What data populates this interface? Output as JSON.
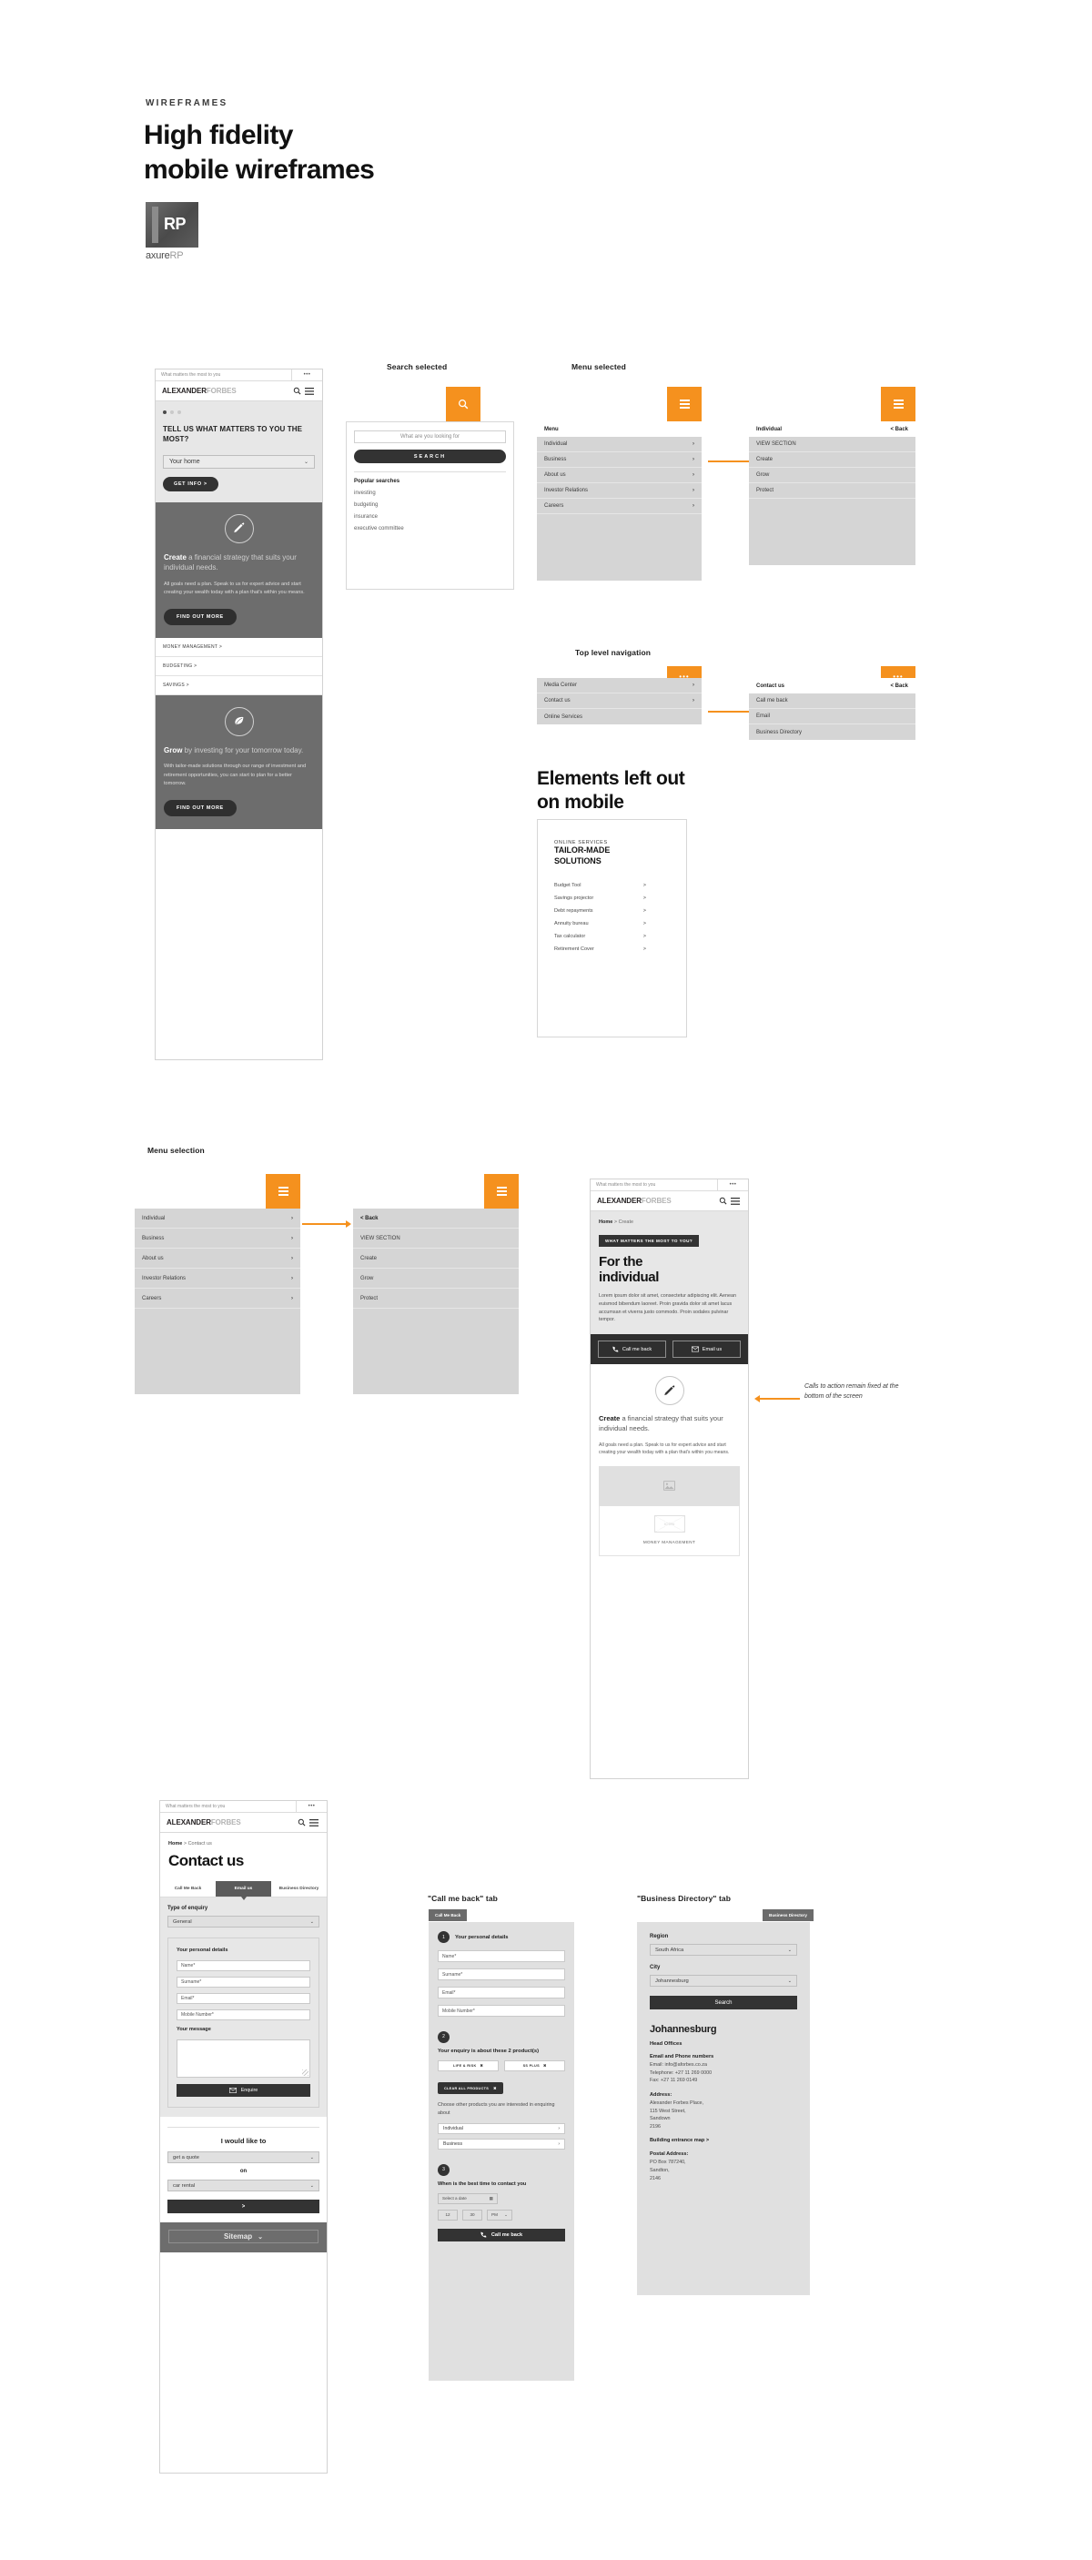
{
  "intro": {
    "kicker": "WIREFRAMES",
    "title_line1": "High fidelity",
    "title_line2": "mobile wireframes",
    "logo_mark": "RP",
    "logo_word": "axure",
    "logo_word_light": "RP"
  },
  "colors": {
    "accent": "#f5911e",
    "dark": "#333333",
    "panel_gray": "#6d6d6d",
    "menu_gray": "#d5d5d5",
    "hero_gray": "#e7e7e7"
  },
  "captions": {
    "search_selected": "Search selected",
    "menu_selected": "Menu selected",
    "top_level_navigation": "Top level navigation",
    "menu_selection": "Menu selection",
    "call_me_back_tab": "\"Call me back\" tab",
    "business_directory_tab": "\"Business Directory\" tab"
  },
  "headings": {
    "elements_left_out_l1": "Elements left out",
    "elements_left_out_l2": "on mobile"
  },
  "annotations": {
    "cta_fixed": "Calls to action remain fixed at the bottom of the screen"
  },
  "browser": {
    "url_text": "What matters the most to you",
    "dots": "•••"
  },
  "brand": {
    "name_bold": "ALEXANDER",
    "name_light": "FORBES"
  },
  "home": {
    "hero_heading": "TELL US WHAT MATTERS TO YOU THE MOST?",
    "select_value": "Your home",
    "cta": "GET INFO >",
    "create": {
      "title_bold": "Create",
      "title_rest": " a financial strategy that suits your individual needs.",
      "body": "All goals need a plan. Speak to us for expert advice and start creating your wealth today with a plan that's within you means.",
      "button": "FIND OUT MORE",
      "icon": "pencil-icon"
    },
    "links": [
      "MONEY MANAGEMENT >",
      "BUDGETING >",
      "SAVINGS >"
    ],
    "grow": {
      "title_bold": "Grow",
      "title_rest": " by investing for your tomorrow today.",
      "body": "With tailor-made solutions through our range of investment and retirement opportunities, you can start to plan for a better tomorrow.",
      "button": "FIND OUT MORE",
      "icon": "leaf-icon"
    }
  },
  "search_dropdown": {
    "input_placeholder": "What are you looking for",
    "search_button": "SEARCH",
    "popular_title": "Popular searches",
    "popular_items": [
      "investing",
      "budgeting",
      "insurance",
      "executive committee"
    ]
  },
  "menu_dropdown": {
    "header": "Menu",
    "items": [
      "Individual",
      "Business",
      "About us",
      "Investor Relations",
      "Careers"
    ]
  },
  "individual_dropdown": {
    "header": "Individual",
    "back": "< Back",
    "items": [
      "VIEW SECTION",
      "Create",
      "Grow",
      "Protect"
    ]
  },
  "toplevel_dropdown": {
    "items": [
      "Media Center",
      "Contact us",
      "Online Services"
    ]
  },
  "contact_dropdown": {
    "header": "Contact us",
    "back": "< Back",
    "items": [
      "Call me back",
      "Email",
      "Business Directory"
    ]
  },
  "menu_selection": {
    "left_items": [
      "Individual",
      "Business",
      "About us",
      "Investor Relations",
      "Careers"
    ],
    "right_back": "< Back",
    "right_items": [
      "VIEW SECTION",
      "Create",
      "Grow",
      "Protect"
    ]
  },
  "tailor_made": {
    "eyebrow": "ONLINE SERVICES",
    "title_l1": "TAILOR-MADE",
    "title_l2": "SOLUTIONS",
    "items": [
      "Budget Tool",
      "Savings projector",
      "Debt repayments",
      "Annuity bureau",
      "Tax calculator",
      "Retirement Cover"
    ],
    "arrow": ">"
  },
  "individual_page": {
    "breadcrumb_home": "Home",
    "breadcrumb_sep": ">",
    "breadcrumb_current": "Create",
    "tag": "WHAT MATTERS THE MOST TO YOU?",
    "title_l1": "For the",
    "title_l2": "individual",
    "body": "Lorem ipsum dolor sit amet, consectetur adipiscing elit. Aenean euismod bibendum laoreet. Proin gravida dolor sit amet lacus accumsan et viverra justo commodo. Proin sodales pulvinar tempor.",
    "cta_call": "Call me back",
    "cta_email": "Email us",
    "create_title_bold": "Create",
    "create_title_rest": " a financial strategy that suits your individual needs.",
    "create_body": "All goals need a plan. Speak to us for expert advice and start creating your wealth today with a plan that's within you means.",
    "icon_label": "ICON",
    "card_caption": "MONEY MANAGEMENT"
  },
  "contact_page": {
    "breadcrumb_home": "Home",
    "breadcrumb_sep": ">",
    "breadcrumb_current": "Contact us",
    "title": "Contact us",
    "tabs": [
      "Call Me Back",
      "Email us",
      "Business Directory"
    ],
    "active_tab": "Email us",
    "enquiry_label": "Type of enquiry",
    "enquiry_value": "General",
    "details_title": "Your personal details",
    "fields": [
      "Name*",
      "Surname*",
      "Email*",
      "Mobile Number*"
    ],
    "message_label": "Your message",
    "enquire_button": "Enquire",
    "iwl_title": "I would like to",
    "iwl_value": "get a quote",
    "iwl_on": "on",
    "iwl_value2": "car rental",
    "iwl_button": ">",
    "sitemap": "Sitemap"
  },
  "call_me_back": {
    "tab_label": "Call Me Back",
    "step1_num": "1",
    "step1_title": "Your personal details",
    "fields": [
      "Name*",
      "Surname*",
      "Email*",
      "Mobile Number*"
    ],
    "step2_num": "2",
    "step2_title": "Your enquiry is about these 2 product(s)",
    "chips": [
      "LIFE & RISK",
      "SS PLUS"
    ],
    "clear_all": "CLEAR ALL PRODUCTS",
    "chip_x": "✖",
    "other_hint": "Choose other products you are interested in enquiring about",
    "other_options": [
      "Individual",
      "Business"
    ],
    "step3_num": "3",
    "step3_title": "When is the best time to contact you",
    "date_placeholder": "Select a date",
    "hour": "12",
    "minute": "30",
    "meridiem": "PM",
    "submit": "Call me back"
  },
  "business_directory": {
    "tab_label": "Business Directory",
    "region_label": "Region",
    "region_value": "South Africa",
    "city_label": "City",
    "city_value": "Johannesburg",
    "search_button": "Search",
    "result_title": "Johannesburg",
    "result_sub": "Head Offices",
    "contact_heading": "Email and Phone numbers",
    "email_line": "Email: info@aforbes.co.za",
    "tel_line": "Telephone: +27 11 269 0000",
    "fax_line": "Fax: +27 11 269 0149",
    "address_heading": "Address:",
    "address_l1": "Alexander Forbes Place,",
    "address_l2": "115 West Street,",
    "address_l3": "Sandown",
    "address_l4": "2196",
    "map_link": "Building entrance map >",
    "postal_heading": "Postal Address:",
    "postal_l1": "PO Box 787240,",
    "postal_l2": "Sandton,",
    "postal_l3": "2146"
  }
}
